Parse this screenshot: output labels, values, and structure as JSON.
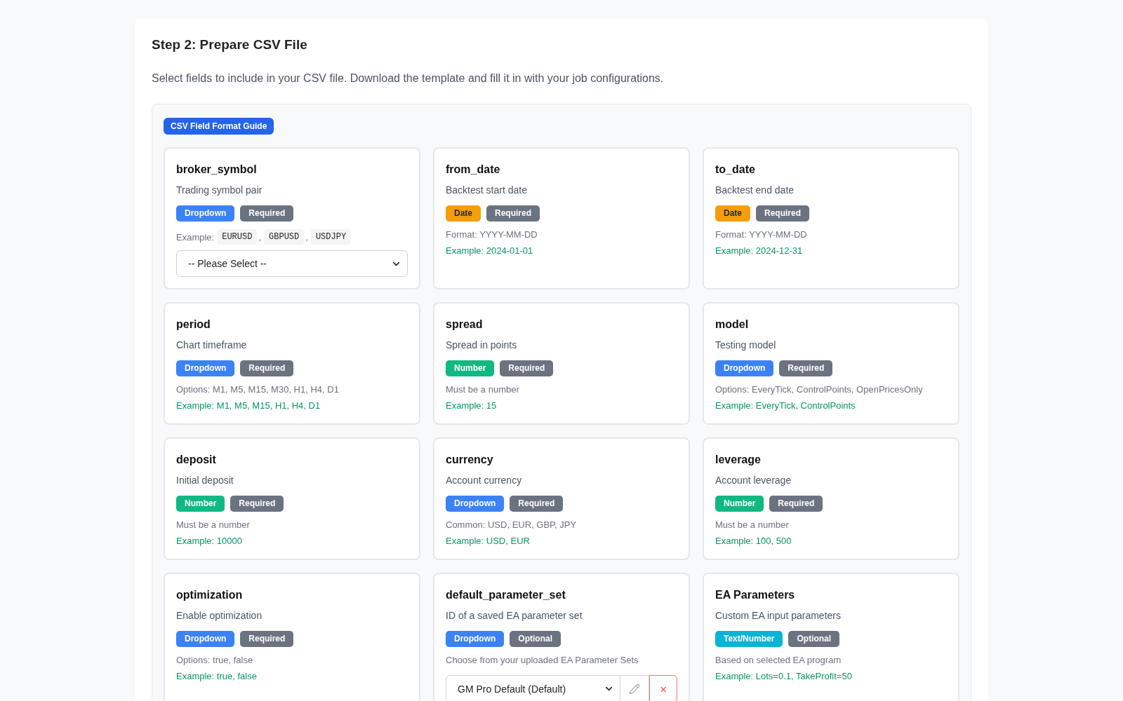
{
  "section": {
    "title": "Step 2: Prepare CSV File",
    "description": "Select fields to include in your CSV file. Download the template and fill it in with your job configurations."
  },
  "guide": {
    "badge": "CSV Field Format Guide",
    "fields": [
      {
        "name": "broker_symbol",
        "description": "Trading symbol pair",
        "badges": [
          {
            "label": "Dropdown",
            "kind": "dropdown"
          },
          {
            "label": "Required",
            "kind": "status"
          }
        ],
        "details": [
          {
            "kind": "chips",
            "label": "Example:",
            "items": [
              {
                "text": "EURUSD",
                "separator": ","
              },
              {
                "text": "GBPUSD",
                "separator": ","
              },
              {
                "text": "USDJPY"
              }
            ]
          },
          {
            "kind": "select",
            "value": "-- Please Select --"
          }
        ]
      },
      {
        "name": "from_date",
        "description": "Backtest start date",
        "badges": [
          {
            "label": "Date",
            "kind": "date"
          },
          {
            "label": "Required",
            "kind": "status"
          }
        ],
        "details": [
          {
            "kind": "note",
            "text": "Format: YYYY-MM-DD"
          },
          {
            "kind": "example",
            "text": "Example: 2024-01-01"
          }
        ]
      },
      {
        "name": "to_date",
        "description": "Backtest end date",
        "badges": [
          {
            "label": "Date",
            "kind": "date"
          },
          {
            "label": "Required",
            "kind": "status"
          }
        ],
        "details": [
          {
            "kind": "note",
            "text": "Format: YYYY-MM-DD"
          },
          {
            "kind": "example",
            "text": "Example: 2024-12-31"
          }
        ]
      },
      {
        "name": "period",
        "description": "Chart timeframe",
        "badges": [
          {
            "label": "Dropdown",
            "kind": "dropdown"
          },
          {
            "label": "Required",
            "kind": "status"
          }
        ],
        "details": [
          {
            "kind": "note",
            "text": "Options: M1, M5, M15, M30, H1, H4, D1"
          },
          {
            "kind": "example",
            "text": "Example: M1, M5, M15, H1, H4, D1"
          }
        ]
      },
      {
        "name": "spread",
        "description": "Spread in points",
        "badges": [
          {
            "label": "Number",
            "kind": "number"
          },
          {
            "label": "Required",
            "kind": "status"
          }
        ],
        "details": [
          {
            "kind": "note",
            "text": "Must be a number"
          },
          {
            "kind": "example",
            "text": "Example: 15"
          }
        ]
      },
      {
        "name": "model",
        "description": "Testing model",
        "badges": [
          {
            "label": "Dropdown",
            "kind": "dropdown"
          },
          {
            "label": "Required",
            "kind": "status"
          }
        ],
        "details": [
          {
            "kind": "note",
            "text": "Options: EveryTick, ControlPoints, OpenPricesOnly"
          },
          {
            "kind": "example",
            "text": "Example: EveryTick, ControlPoints"
          }
        ]
      },
      {
        "name": "deposit",
        "description": "Initial deposit",
        "badges": [
          {
            "label": "Number",
            "kind": "number"
          },
          {
            "label": "Required",
            "kind": "status"
          }
        ],
        "details": [
          {
            "kind": "note",
            "text": "Must be a number"
          },
          {
            "kind": "example",
            "text": "Example: 10000"
          }
        ]
      },
      {
        "name": "currency",
        "description": "Account currency",
        "badges": [
          {
            "label": "Dropdown",
            "kind": "dropdown"
          },
          {
            "label": "Required",
            "kind": "status"
          }
        ],
        "details": [
          {
            "kind": "note",
            "text": "Common: USD, EUR, GBP, JPY"
          },
          {
            "kind": "example",
            "text": "Example: USD, EUR"
          }
        ]
      },
      {
        "name": "leverage",
        "description": "Account leverage",
        "badges": [
          {
            "label": "Number",
            "kind": "number"
          },
          {
            "label": "Required",
            "kind": "status"
          }
        ],
        "details": [
          {
            "kind": "note",
            "text": "Must be a number"
          },
          {
            "kind": "example",
            "text": "Example: 100, 500"
          }
        ]
      },
      {
        "name": "optimization",
        "description": "Enable optimization",
        "badges": [
          {
            "label": "Dropdown",
            "kind": "dropdown"
          },
          {
            "label": "Required",
            "kind": "status"
          }
        ],
        "details": [
          {
            "kind": "note",
            "text": "Options: true, false"
          },
          {
            "kind": "example",
            "text": "Example: true, false"
          }
        ]
      },
      {
        "name": "default_parameter_set",
        "description": "ID of a saved EA parameter set",
        "badges": [
          {
            "label": "Dropdown",
            "kind": "dropdown"
          },
          {
            "label": "Optional",
            "kind": "status"
          }
        ],
        "details": [
          {
            "kind": "note",
            "text": "Choose from your uploaded EA Parameter Sets"
          },
          {
            "kind": "select_group",
            "value": "GM Pro Default (Default)",
            "delete_label": "×"
          }
        ]
      },
      {
        "name": "EA Parameters",
        "description": "Custom EA input parameters",
        "badges": [
          {
            "label": "Text/Number",
            "kind": "text_number"
          },
          {
            "label": "Optional",
            "kind": "status"
          }
        ],
        "details": [
          {
            "kind": "note",
            "text": "Based on selected EA program"
          },
          {
            "kind": "example",
            "text": "Example: Lots=0.1, TakeProfit=50"
          }
        ]
      }
    ]
  }
}
